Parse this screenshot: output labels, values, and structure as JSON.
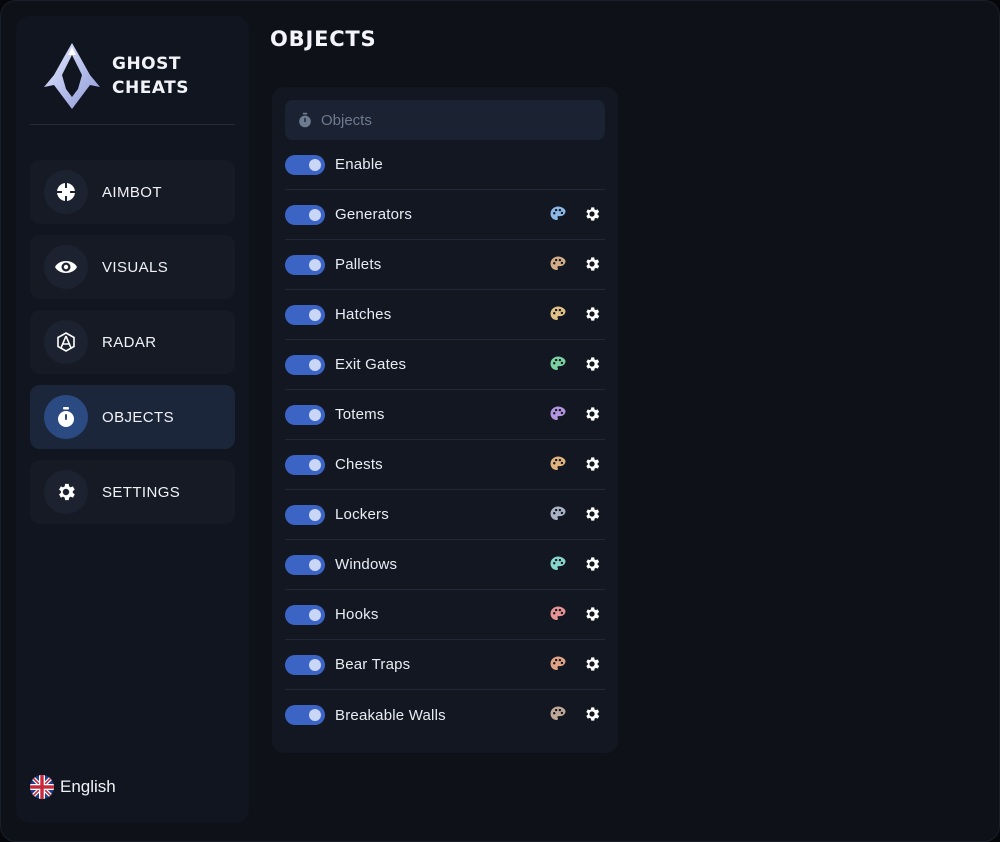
{
  "app": {
    "brand_line1": "GHOST",
    "brand_line2": "CHEATS",
    "accent_color": "#3c64c5"
  },
  "sidebar": {
    "items": [
      {
        "label": "AIMBOT",
        "icon": "crosshair-icon",
        "active": false
      },
      {
        "label": "VISUALS",
        "icon": "eye-icon",
        "active": false
      },
      {
        "label": "RADAR",
        "icon": "radar-icon",
        "active": false
      },
      {
        "label": "OBJECTS",
        "icon": "stopwatch-icon",
        "active": true
      },
      {
        "label": "SETTINGS",
        "icon": "gear-icon",
        "active": false
      }
    ],
    "language": "English",
    "language_icon": "uk-flag-icon"
  },
  "main": {
    "title": "OBJECTS",
    "panel_header": "Objects",
    "panel_header_icon": "stopwatch-icon",
    "rows": [
      {
        "label": "Enable",
        "enabled": true,
        "color": null
      },
      {
        "label": "Generators",
        "enabled": true,
        "color": "#8cb8e6"
      },
      {
        "label": "Pallets",
        "enabled": true,
        "color": "#d2ad86"
      },
      {
        "label": "Hatches",
        "enabled": true,
        "color": "#e2c185"
      },
      {
        "label": "Exit Gates",
        "enabled": true,
        "color": "#7bd1a2"
      },
      {
        "label": "Totems",
        "enabled": true,
        "color": "#b495e0"
      },
      {
        "label": "Chests",
        "enabled": true,
        "color": "#e0b47c"
      },
      {
        "label": "Lockers",
        "enabled": true,
        "color": "#a9b3c4"
      },
      {
        "label": "Windows",
        "enabled": true,
        "color": "#86d6cc"
      },
      {
        "label": "Hooks",
        "enabled": true,
        "color": "#e59393"
      },
      {
        "label": "Bear Traps",
        "enabled": true,
        "color": "#e0a383"
      },
      {
        "label": "Breakable Walls",
        "enabled": true,
        "color": "#bfa896"
      }
    ]
  }
}
